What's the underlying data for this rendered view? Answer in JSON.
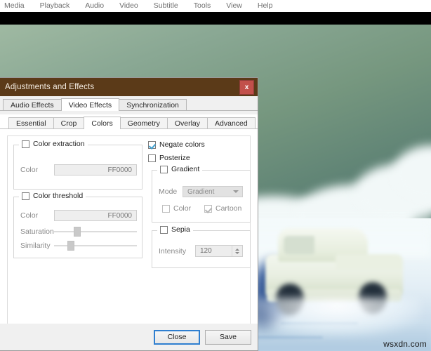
{
  "menubar": {
    "items": [
      "Media",
      "Playback",
      "Audio",
      "Video",
      "Subtitle",
      "Tools",
      "View",
      "Help"
    ]
  },
  "video": {
    "watermark": "wsxdn.com",
    "description": "negated-colors video frame of a car driving through snow under a green sky"
  },
  "dialog": {
    "title": "Adjustments and Effects",
    "close_label": "x",
    "outer_tabs": [
      {
        "label": "Audio Effects",
        "active": false
      },
      {
        "label": "Video Effects",
        "active": true
      },
      {
        "label": "Synchronization",
        "active": false
      }
    ],
    "inner_tabs": [
      {
        "label": "Essential",
        "active": false
      },
      {
        "label": "Crop",
        "active": false
      },
      {
        "label": "Colors",
        "active": true
      },
      {
        "label": "Geometry",
        "active": false
      },
      {
        "label": "Overlay",
        "active": false
      },
      {
        "label": "Advanced",
        "active": false
      }
    ],
    "colors_page": {
      "color_extraction": {
        "title": "Color extraction",
        "checked": false,
        "color_label": "Color",
        "color_value": "FF0000"
      },
      "color_threshold": {
        "title": "Color threshold",
        "checked": false,
        "color_label": "Color",
        "color_value": "FF0000",
        "saturation_label": "Saturation",
        "saturation_pct": 24,
        "similarity_label": "Similarity",
        "similarity_pct": 16
      },
      "negate_colors": {
        "label": "Negate colors",
        "checked": true
      },
      "posterize": {
        "label": "Posterize",
        "checked": false
      },
      "gradient": {
        "title": "Gradient",
        "checked": false,
        "mode_label": "Mode",
        "mode_value": "Gradient",
        "color_label": "Color",
        "color_checked": false,
        "cartoon_label": "Cartoon",
        "cartoon_checked": true
      },
      "sepia": {
        "title": "Sepia",
        "checked": false,
        "intensity_label": "Intensity",
        "intensity_value": "120"
      }
    },
    "footer": {
      "close_label": "Close",
      "save_label": "Save"
    }
  },
  "colors": {
    "titlebar": "#5b3a18",
    "close_button": "#c2504b",
    "accent_check": "#3f9fd0",
    "focus_border": "#2f7fd0"
  }
}
